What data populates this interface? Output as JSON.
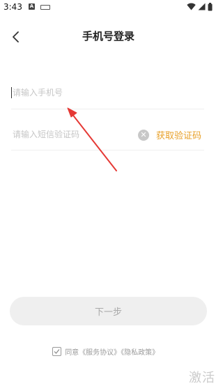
{
  "status_bar": {
    "time": "3:43",
    "icon_a_label": "A"
  },
  "header": {
    "title": "手机号登录"
  },
  "phone_field": {
    "placeholder": "请输入手机号"
  },
  "sms_field": {
    "placeholder": "请输入短信验证码",
    "get_code_label": "获取验证码"
  },
  "next_button": {
    "label": "下一步"
  },
  "agreement": {
    "prefix": "同意",
    "service": "《服务协议》",
    "privacy": "《隐私政策》"
  },
  "watermark": {
    "text": "激活"
  },
  "colors": {
    "accent": "#e8a12a",
    "annotation_arrow": "#e53935"
  }
}
